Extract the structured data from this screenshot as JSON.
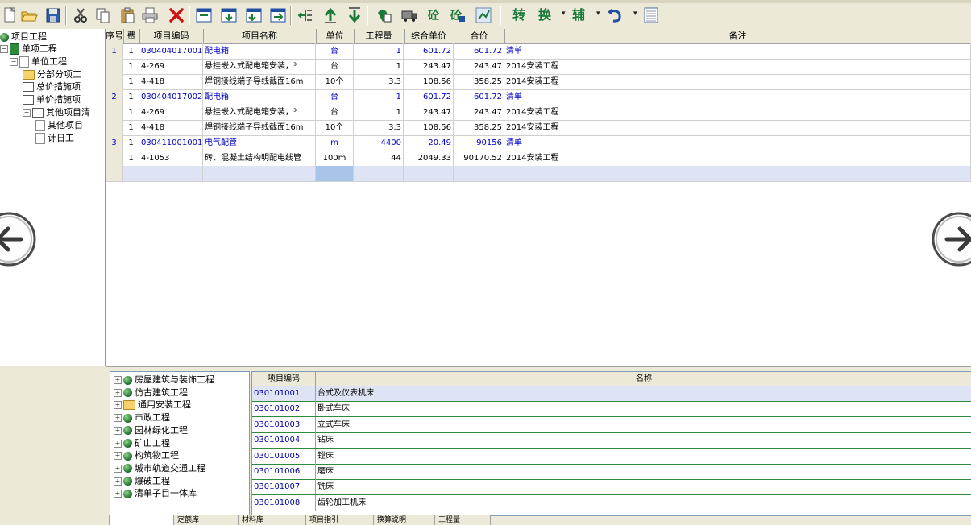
{
  "toolbar": {
    "icons": [
      "new-icon",
      "open-icon",
      "save-icon",
      "cut-icon",
      "copy-icon",
      "paste-icon",
      "print-icon",
      "delete-icon",
      "insert-row-icon",
      "add-row-icon",
      "add-child-icon",
      "append-icon",
      "outdent-icon",
      "move-up-icon",
      "move-down-icon",
      "calculate-icon",
      "truck-icon",
      "concrete-icon",
      "material-icon",
      "chart-icon"
    ],
    "text_buttons": [
      "转",
      "换",
      "辅"
    ],
    "colors": {
      "accent": "#1a7a3a",
      "icon_blue": "#1f4fa0",
      "delete_red": "#d01010"
    }
  },
  "tree": {
    "items": [
      {
        "label": "项目工程",
        "level": 0
      },
      {
        "label": "单项工程",
        "level": 1
      },
      {
        "label": "单位工程",
        "level": 2
      },
      {
        "label": "分部分项工",
        "level": 3
      },
      {
        "label": "总价措施项",
        "level": 3
      },
      {
        "label": "单价措施项",
        "level": 3
      },
      {
        "label": "其他项目清",
        "level": 3
      },
      {
        "label": "其他项目",
        "level": 4
      },
      {
        "label": "计日工",
        "level": 4
      }
    ]
  },
  "grid": {
    "headers": [
      "序号",
      "费",
      "项目编码",
      "项目名称",
      "单位",
      "工程量",
      "综合单价",
      "合价",
      "备注"
    ],
    "rows": [
      {
        "seq": "1",
        "fee": "1",
        "code": "030404017001",
        "name": "配电箱",
        "unit": "台",
        "qty": "1",
        "price": "601.72",
        "total": "601.72",
        "remark": "清单",
        "type": "list"
      },
      {
        "seq": "",
        "fee": "1",
        "code": "4-269",
        "name": "悬挂嵌入式配电箱安装，³",
        "unit": "台",
        "qty": "1",
        "price": "243.47",
        "total": "243.47",
        "remark": "2014安装工程",
        "type": "sub"
      },
      {
        "seq": "",
        "fee": "1",
        "code": "4-418",
        "name": "焊铜接线端子导线截面16m",
        "unit": "10个",
        "qty": "3.3",
        "price": "108.56",
        "total": "358.25",
        "remark": "2014安装工程",
        "type": "sub"
      },
      {
        "seq": "2",
        "fee": "1",
        "code": "030404017002",
        "name": "配电箱",
        "unit": "台",
        "qty": "1",
        "price": "601.72",
        "total": "601.72",
        "remark": "清单",
        "type": "list"
      },
      {
        "seq": "",
        "fee": "1",
        "code": "4-269",
        "name": "悬挂嵌入式配电箱安装，³",
        "unit": "台",
        "qty": "1",
        "price": "243.47",
        "total": "243.47",
        "remark": "2014安装工程",
        "type": "sub"
      },
      {
        "seq": "",
        "fee": "1",
        "code": "4-418",
        "name": "焊铜接线端子导线截面16m",
        "unit": "10个",
        "qty": "3.3",
        "price": "108.56",
        "total": "358.25",
        "remark": "2014安装工程",
        "type": "sub"
      },
      {
        "seq": "3",
        "fee": "1",
        "code": "030411001001",
        "name": "电气配管",
        "unit": "m",
        "qty": "4400",
        "price": "20.49",
        "total": "90156",
        "remark": "清单",
        "type": "list"
      },
      {
        "seq": "",
        "fee": "1",
        "code": "4-1053",
        "name": "砖、混凝土结构明配电线管",
        "unit": "100m",
        "qty": "44",
        "price": "2049.33",
        "total": "90170.52",
        "remark": "2014安装工程",
        "type": "sub"
      }
    ]
  },
  "library": {
    "tree": [
      {
        "label": "房屋建筑与装饰工程",
        "icon": "globe-icon"
      },
      {
        "label": "仿古建筑工程",
        "icon": "globe-icon"
      },
      {
        "label": "通用安装工程",
        "icon": "folder-open-icon"
      },
      {
        "label": "市政工程",
        "icon": "globe-icon"
      },
      {
        "label": "园林绿化工程",
        "icon": "globe-icon"
      },
      {
        "label": "矿山工程",
        "icon": "globe-icon"
      },
      {
        "label": "构筑物工程",
        "icon": "globe-icon"
      },
      {
        "label": "城市轨道交通工程",
        "icon": "globe-icon"
      },
      {
        "label": "爆破工程",
        "icon": "globe-icon"
      },
      {
        "label": "清单子目一体库",
        "icon": "globe-icon"
      }
    ],
    "headers": [
      "项目编码",
      "名称"
    ],
    "rows": [
      {
        "code": "030101001",
        "name": "台式及仪表机床"
      },
      {
        "code": "030101002",
        "name": "卧式车床"
      },
      {
        "code": "030101003",
        "name": "立式车床"
      },
      {
        "code": "030101004",
        "name": "钻床"
      },
      {
        "code": "030101005",
        "name": "镗床"
      },
      {
        "code": "030101006",
        "name": "磨床"
      },
      {
        "code": "030101007",
        "name": "铣床"
      },
      {
        "code": "030101008",
        "name": "齿轮加工机床"
      }
    ],
    "tabs": [
      "",
      "定额库",
      "材料库",
      "项目指引",
      "换算说明",
      "工程量"
    ]
  }
}
